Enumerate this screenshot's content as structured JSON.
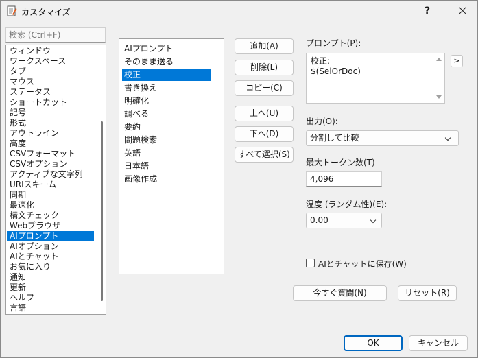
{
  "window": {
    "title": "カスタマイズ",
    "help_glyph": "?"
  },
  "search": {
    "placeholder": "検索 (Ctrl+F)"
  },
  "nav": {
    "items": [
      "ウィンドウ",
      "ワークスペース",
      "タブ",
      "マウス",
      "ステータス",
      "ショートカット",
      "記号",
      "形式",
      "アウトライン",
      "高度",
      "CSVフォーマット",
      "CSVオプション",
      "アクティブな文字列",
      "URIスキーム",
      "同期",
      "最適化",
      "構文チェック",
      "Webブラウザ",
      "AIプロンプト",
      "AIオプション",
      "AIとチャット",
      "お気に入り",
      "通知",
      "更新",
      "ヘルプ",
      "言語"
    ],
    "selected": "AIプロンプト"
  },
  "prompts": {
    "header": "AIプロンプト",
    "items": [
      "そのまま送る",
      "校正",
      "書き換え",
      "明確化",
      "調べる",
      "要約",
      "問題検索",
      "英語",
      "日本語",
      "画像作成"
    ],
    "selected": "校正"
  },
  "buttons": {
    "add": "追加(A)",
    "delete": "削除(L)",
    "copy": "コピー(C)",
    "up": "上へ(U)",
    "down": "下へ(D)",
    "select_all": "すべて選択(S)",
    "expand": ">",
    "ask_now": "今すぐ質問(N)",
    "reset": "リセット(R)",
    "ok": "OK",
    "cancel": "キャンセル"
  },
  "form": {
    "prompt_label": "プロンプト(P):",
    "prompt_value": "校正:\n$(SelOrDoc)",
    "output_label": "出力(O):",
    "output_value": "分割して比較",
    "max_tokens_label": "最大トークン数(T)",
    "max_tokens_value": "4,096",
    "temperature_label": "温度 (ランダム性)(E):",
    "temperature_value": "0.00",
    "save_to_chat_label": "AIとチャットに保存(W)",
    "save_to_chat_checked": false
  },
  "colors": {
    "selection": "#0078d7",
    "window_bg": "#f0f0f0",
    "default_button_border": "#0067c0"
  }
}
